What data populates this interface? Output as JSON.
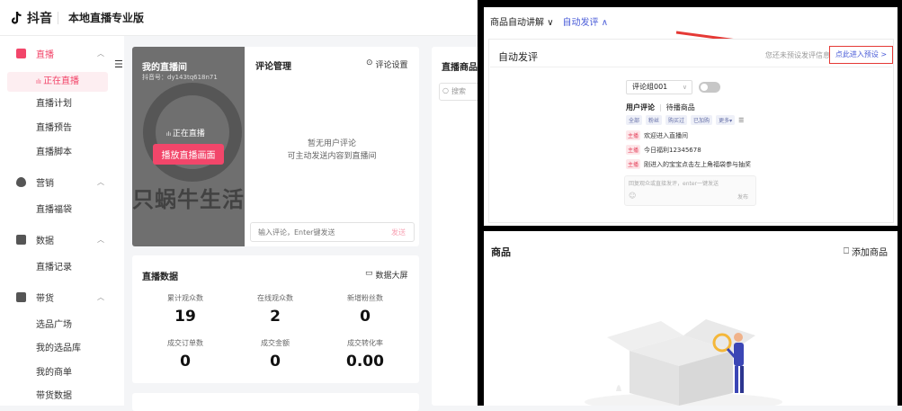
{
  "app": {
    "logo_text": "抖音",
    "product_name": "本地直播专业版"
  },
  "sidebar": {
    "groups": [
      {
        "label": "直播",
        "icon": "tv-icon",
        "color": "#f2466a",
        "items": [
          "正在直播",
          "直播计划",
          "直播预告",
          "直播脚本"
        ]
      },
      {
        "label": "营销",
        "icon": "flame-icon",
        "items": [
          "直播福袋"
        ]
      },
      {
        "label": "数据",
        "icon": "chart-icon",
        "items": [
          "直播记录"
        ]
      },
      {
        "label": "带货",
        "icon": "bag-icon",
        "items": [
          "选品广场",
          "我的选品库",
          "我的商单",
          "带货数据"
        ]
      }
    ],
    "active_item": "正在直播"
  },
  "live_room": {
    "title": "我的直播间",
    "account": "抖音号：dy143tq618n71",
    "status": "正在直播",
    "play_button": "播放直播画面",
    "watermark": "只蜗牛生活"
  },
  "comments": {
    "title": "评论管理",
    "settings": "评论设置",
    "empty_line1": "暂无用户评论",
    "empty_line2": "可主动发送内容到直播间",
    "input_placeholder": "输入评论，Enter键发送",
    "send": "发送"
  },
  "goods_col": {
    "title": "直播商品",
    "search_placeholder": "搜索"
  },
  "live_data": {
    "title": "直播数据",
    "big_screen": "数据大屏",
    "stats": [
      {
        "label": "累计观众数",
        "value": "19"
      },
      {
        "label": "在线观众数",
        "value": "2"
      },
      {
        "label": "新增粉丝数",
        "value": "0"
      },
      {
        "label": "成交订单数",
        "value": "0"
      },
      {
        "label": "成交金额",
        "value": "0"
      },
      {
        "label": "成交转化率",
        "value": "0.00"
      }
    ]
  },
  "zoom_panel": {
    "tab1": "商品自动讲解",
    "tab2": "自动发评",
    "section_title": "自动发评",
    "hint": "您还未预设发评信息",
    "enter_preset": "点此进入预设 >",
    "group_select": "评论组001",
    "tab_user_comment": "用户评论",
    "tab_pending_goods": "待播商品",
    "chips": [
      "全部",
      "粉丝",
      "购买过",
      "已加购",
      "更多"
    ],
    "messages": [
      {
        "tag": "主播",
        "text": "欢迎进入直播间"
      },
      {
        "tag": "主播",
        "text": "今日福利12345678"
      },
      {
        "tag": "主播",
        "text": "刚进入的宝宝点击左上角福袋参与抽奖"
      }
    ],
    "reply_placeholder": "回复观众或直接发评，enter一键发送",
    "reply_send": "发布"
  },
  "goods_panel": {
    "title": "商品",
    "add_goods": "添加商品"
  },
  "colors": {
    "accent": "#f2466a",
    "link": "#4a5cd8",
    "highlight_red": "#e53935"
  }
}
